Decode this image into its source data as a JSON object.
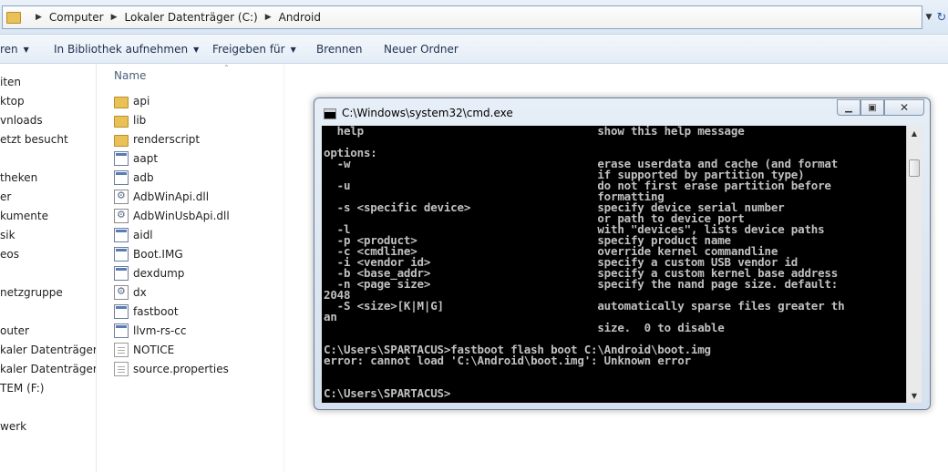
{
  "address": {
    "crumbs": [
      "Computer",
      "Lokaler Datenträger (C:)",
      "Android"
    ]
  },
  "toolbar": {
    "items": [
      "ren",
      "In Bibliothek aufnehmen",
      "Freigeben für",
      "Brennen",
      "Neuer Ordner"
    ]
  },
  "nav": {
    "items": [
      "iten",
      "ktop",
      "vnloads",
      "etzt besucht",
      "theken",
      "er",
      "kumente",
      "sik",
      "eos",
      "netzgruppe",
      "outer",
      "kaler Datenträger (C:)",
      "kaler Datenträger (D:)",
      "TEM (F:)",
      "werk"
    ]
  },
  "filelist": {
    "column_name": "Name",
    "files": [
      {
        "name": "api",
        "icon": "folder-icon"
      },
      {
        "name": "lib",
        "icon": "folder-icon"
      },
      {
        "name": "renderscript",
        "icon": "folder-icon"
      },
      {
        "name": "aapt",
        "icon": "exe-icon"
      },
      {
        "name": "adb",
        "icon": "exe-icon"
      },
      {
        "name": "AdbWinApi.dll",
        "icon": "dll-icon"
      },
      {
        "name": "AdbWinUsbApi.dll",
        "icon": "dll-icon"
      },
      {
        "name": "aidl",
        "icon": "exe-icon"
      },
      {
        "name": "Boot.IMG",
        "icon": "exe-icon"
      },
      {
        "name": "dexdump",
        "icon": "exe-icon"
      },
      {
        "name": "dx",
        "icon": "dll-icon"
      },
      {
        "name": "fastboot",
        "icon": "exe-icon"
      },
      {
        "name": "llvm-rs-cc",
        "icon": "exe-icon"
      },
      {
        "name": "NOTICE",
        "icon": "document-icon"
      },
      {
        "name": "source.properties",
        "icon": "document-icon"
      }
    ]
  },
  "cmd": {
    "title": "C:\\Windows\\system32\\cmd.exe",
    "lines": [
      "  help                                   show this help message",
      "",
      "options:",
      "  -w                                     erase userdata and cache (and format",
      "                                         if supported by partition type)",
      "  -u                                     do not first erase partition before",
      "                                         formatting",
      "  -s <specific device>                   specify device serial number",
      "                                         or path to device port",
      "  -l                                     with \"devices\", lists device paths",
      "  -p <product>                           specify product name",
      "  -c <cmdline>                           override kernel commandline",
      "  -i <vendor id>                         specify a custom USB vendor id",
      "  -b <base_addr>                         specify a custom kernel base address",
      "  -n <page size>                         specify the nand page size. default:",
      "2048",
      "  -S <size>[K|M|G]                       automatically sparse files greater th",
      "an",
      "                                         size.  0 to disable",
      "",
      "C:\\Users\\SPARTACUS>fastboot flash boot C:\\Android\\boot.img",
      "error: cannot load 'C:\\Android\\boot.img': Unknown error",
      "",
      "",
      "C:\\Users\\SPARTACUS>"
    ]
  }
}
